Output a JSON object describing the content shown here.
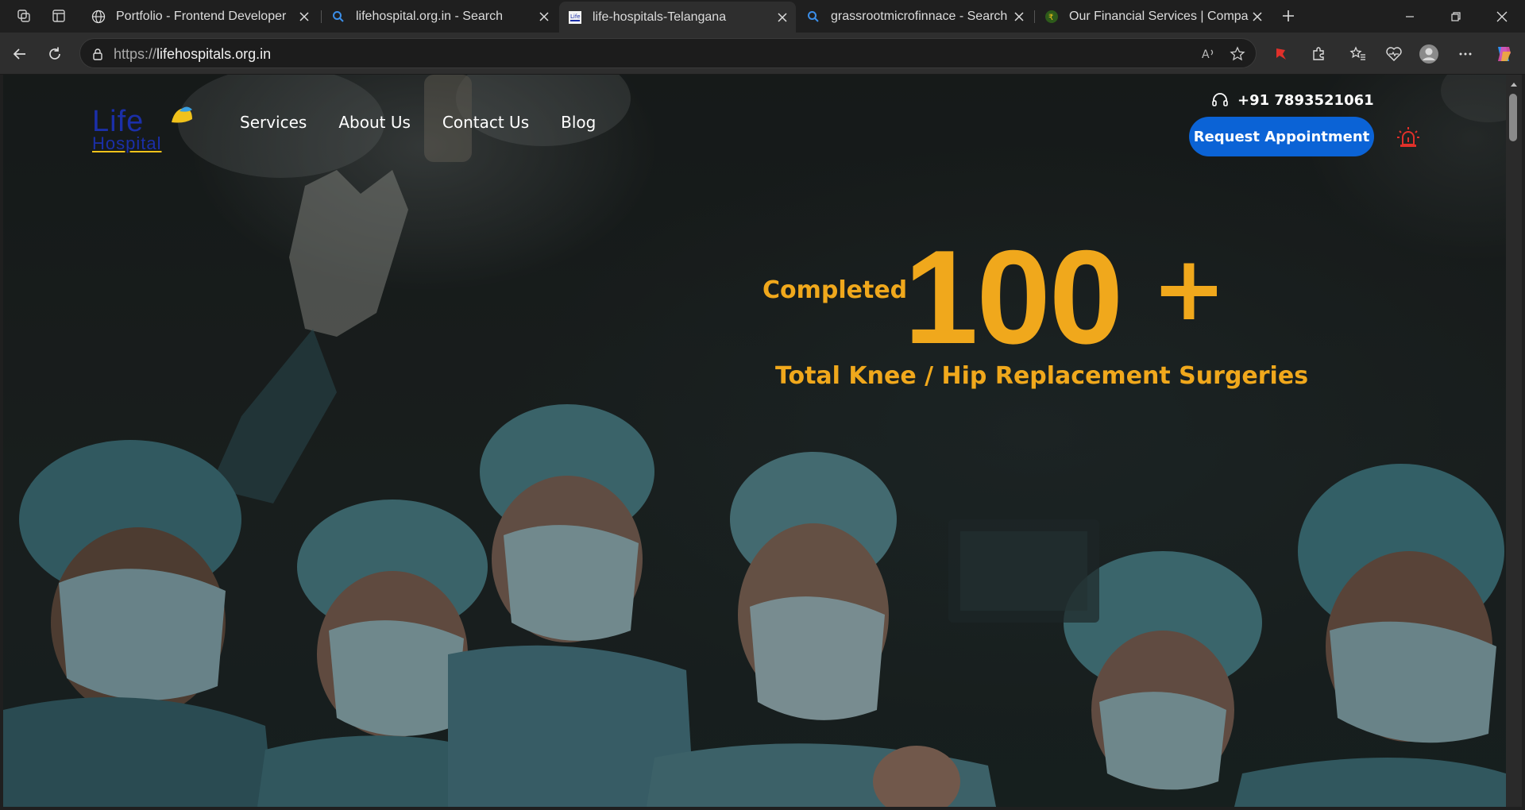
{
  "browser": {
    "tabs": [
      {
        "title": "Portfolio - Frontend Developer",
        "favicon": "globe-icon",
        "active": false
      },
      {
        "title": "lifehospital.org.in - Search",
        "favicon": "search-icon",
        "active": false
      },
      {
        "title": "life-hospitals-Telangana",
        "favicon": "site-favicon",
        "active": true
      },
      {
        "title": "grassrootmicrofinnace - Search",
        "favicon": "search-icon",
        "active": false
      },
      {
        "title": "Our Financial Services | Company",
        "favicon": "company-favicon",
        "active": false
      }
    ],
    "address": {
      "protocol": "https://",
      "domain": "lifehospitals.org.in"
    }
  },
  "site": {
    "logo": {
      "line1": "Life",
      "line2": "Hospital"
    },
    "nav": [
      "Services",
      "About Us",
      "Contact Us",
      "Blog"
    ],
    "phone": "+91 7893521061",
    "cta": "Request Appointment",
    "hero": {
      "prefix": "Completed",
      "number": "100",
      "suffix": "+",
      "subtitle": "Total Knee / Hip Replacement Surgeries"
    }
  },
  "colors": {
    "accent_gold": "#f0a81c",
    "cta_blue": "#0b63d6",
    "logo_blue": "#1b2fa8",
    "alarm_red": "#e0302a"
  }
}
